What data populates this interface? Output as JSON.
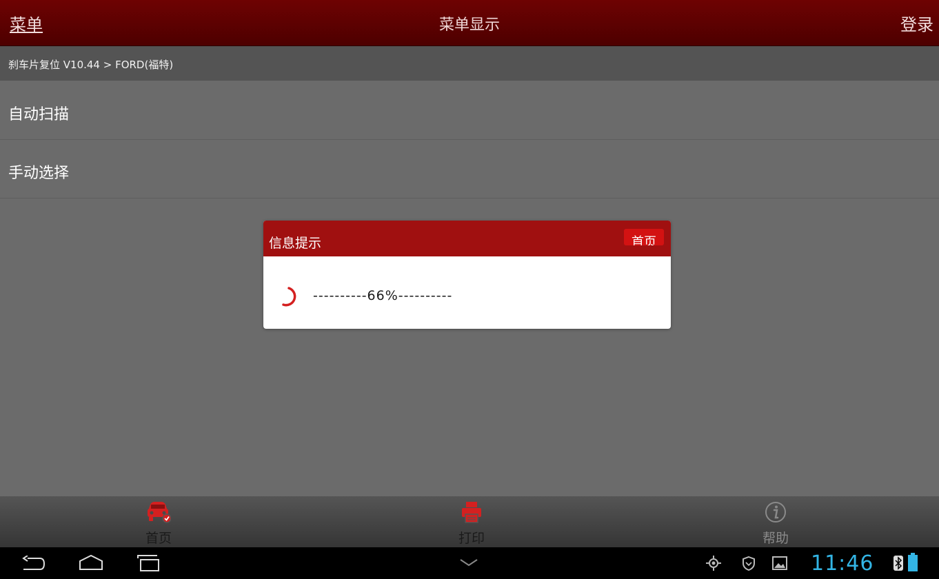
{
  "header": {
    "menu_label": "菜单",
    "title": "菜单显示",
    "login_label": "登录",
    "bar_color": "#5e0101"
  },
  "breadcrumb": "刹车片复位 V10.44 > FORD(福特)",
  "menu_items": [
    {
      "label": "自动扫描"
    },
    {
      "label": "手动选择"
    }
  ],
  "dialog": {
    "title": "信息提示",
    "home_button": "首页",
    "message": "----------66%----------",
    "progress_percent": 66,
    "accent_color": "#d31212"
  },
  "toolbar": {
    "items": [
      {
        "label": "首页",
        "icon": "car-icon",
        "color": "#d42020"
      },
      {
        "label": "打印",
        "icon": "printer-icon",
        "color": "#d42020"
      },
      {
        "label": "帮助",
        "icon": "info-icon",
        "color": "#8a8a8a"
      }
    ]
  },
  "system_bar": {
    "time": "11:46",
    "icons": [
      "back-icon",
      "home-icon",
      "recents-icon",
      "chevron-down-icon",
      "location-icon",
      "shield-icon",
      "gallery-icon",
      "bluetooth-icon",
      "battery-icon"
    ],
    "time_color": "#33b5e5"
  }
}
